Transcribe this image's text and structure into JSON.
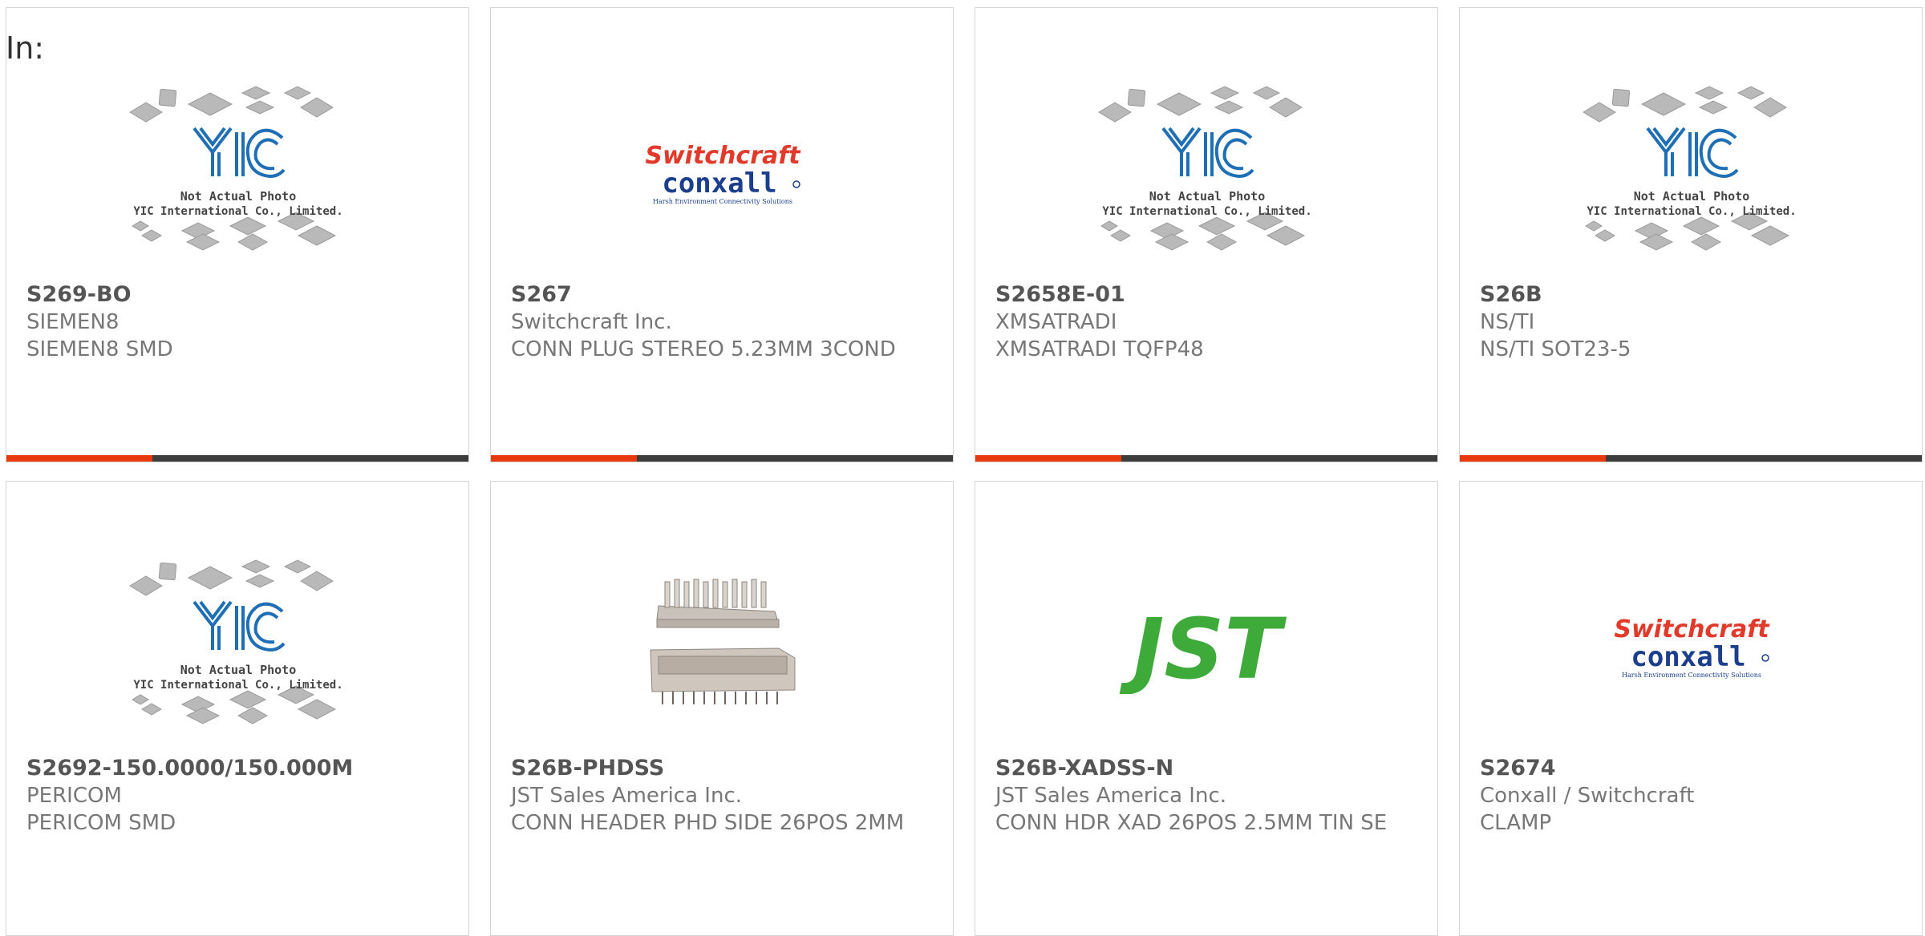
{
  "header": {
    "label": "In:"
  },
  "colors": {
    "accent": "#e8380d",
    "bar": "#3c3c3c",
    "yic_blue": "#1e6fb5",
    "jst_green": "#3daa3a",
    "switchcraft_red": "#e23a2a",
    "conxall_blue": "#1b3f8c"
  },
  "placeholder_image": {
    "icon": "yic-placeholder-icon",
    "caption_line1": "Not Actual Photo",
    "caption_line2": "YIC International Co., Limited."
  },
  "logos": {
    "switchcraft": {
      "line1": "Switchcraft",
      "line2": "conxall",
      "tagline": "Harsh Environment Connectivity Solutions"
    },
    "jst": {
      "text": "JST"
    }
  },
  "products": [
    {
      "part": "S269-BO",
      "manufacturer": "SIEMEN8",
      "description": "SIEMEN8 SMD",
      "image": "yic-placeholder"
    },
    {
      "part": "S267",
      "manufacturer": "Switchcraft Inc.",
      "description": "CONN PLUG STEREO 5.23MM 3COND",
      "image": "switchcraft-logo"
    },
    {
      "part": "S2658E-01",
      "manufacturer": "XMSATRADI",
      "description": "XMSATRADI TQFP48",
      "image": "yic-placeholder"
    },
    {
      "part": "S26B",
      "manufacturer": "NS/TI",
      "description": "NS/TI SOT23-5",
      "image": "yic-placeholder"
    },
    {
      "part": "S2692-150.0000/150.000M",
      "manufacturer": "PERICOM",
      "description": "PERICOM SMD",
      "image": "yic-placeholder"
    },
    {
      "part": "S26B-PHDSS",
      "manufacturer": "JST Sales America Inc.",
      "description": "CONN HEADER PHD SIDE 26POS 2MM",
      "image": "connector-photo"
    },
    {
      "part": "S26B-XADSS-N",
      "manufacturer": "JST Sales America Inc.",
      "description": "CONN HDR XAD 26POS 2.5MM TIN SE",
      "image": "jst-logo"
    },
    {
      "part": "S2674",
      "manufacturer": "Conxall / Switchcraft",
      "description": "CLAMP",
      "image": "switchcraft-logo"
    }
  ]
}
